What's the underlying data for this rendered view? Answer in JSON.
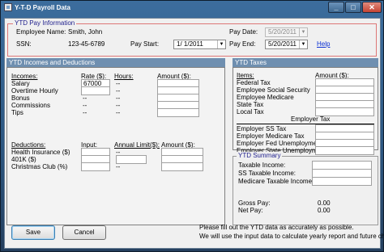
{
  "window": {
    "title": "Y-T-D Payroll Data"
  },
  "pay_info": {
    "group_title": "YTD Pay Information",
    "employee_name_label": "Employee Name:",
    "employee_name": "Smith, John",
    "ssn_label": "SSN:",
    "ssn": "123-45-6789",
    "pay_start_label": "Pay Start:",
    "pay_start": "1/  1/2011",
    "pay_date_label": "Pay Date:",
    "pay_date": "5/20/2011",
    "pay_end_label": "Pay End:",
    "pay_end": "5/20/2011",
    "help_link": "Help"
  },
  "incomes": {
    "header": "YTD Incomes and Deductions",
    "col_incomes": "Incomes:",
    "col_rate": "Rate ($):",
    "col_hours": "Hours:",
    "col_amount": "Amount ($):",
    "rows": [
      {
        "label": "Salary",
        "rate": "67000",
        "hours": "--"
      },
      {
        "label": "Overtime Hourly",
        "rate": "",
        "hours": "--"
      },
      {
        "label": "Bonus",
        "rate": "--",
        "hours": "--"
      },
      {
        "label": "Commissions",
        "rate": "--",
        "hours": "--"
      },
      {
        "label": "Tips",
        "rate": "--",
        "hours": "--"
      }
    ],
    "col_deductions": "Deductions:",
    "col_input": "Input:",
    "col_annual_limit": "Annual Limit($):",
    "col_amount2": "Amount ($):",
    "deductions": [
      {
        "label": "Health Insurance ($)",
        "limit": "--"
      },
      {
        "label": "401K ($)",
        "limit": ""
      },
      {
        "label": "Christmas Club (%)",
        "limit": "--"
      }
    ]
  },
  "taxes": {
    "header": "YTD Taxes",
    "col_items": "Items:",
    "col_amount": "Amount ($):",
    "items": [
      "Federal Tax",
      "Employee Social Security",
      "Employee Medicare",
      "State Tax",
      "Local Tax"
    ],
    "employer_title": "Employer Tax",
    "employer_items": [
      "Employer SS Tax",
      "Employer Medicare Tax",
      "Employer Fed Unemployment",
      "Employer State Unemployment"
    ]
  },
  "summary": {
    "group_title": "YTD Summary",
    "taxable_income_label": "Taxable Income:",
    "ss_taxable_label": "SS Taxable Income:",
    "medicare_taxable_label": "Medicare Taxable Income:",
    "gross_pay_label": "Gross Pay:",
    "gross_pay": "0.00",
    "net_pay_label": "Net Pay:",
    "net_pay": "0.00"
  },
  "footer": {
    "save": "Save",
    "cancel": "Cancel",
    "note_line1": "Please fill out the YTD data as accurately as possible.",
    "note_line2": "We will use the input data to calculate yearly report and future checks."
  }
}
